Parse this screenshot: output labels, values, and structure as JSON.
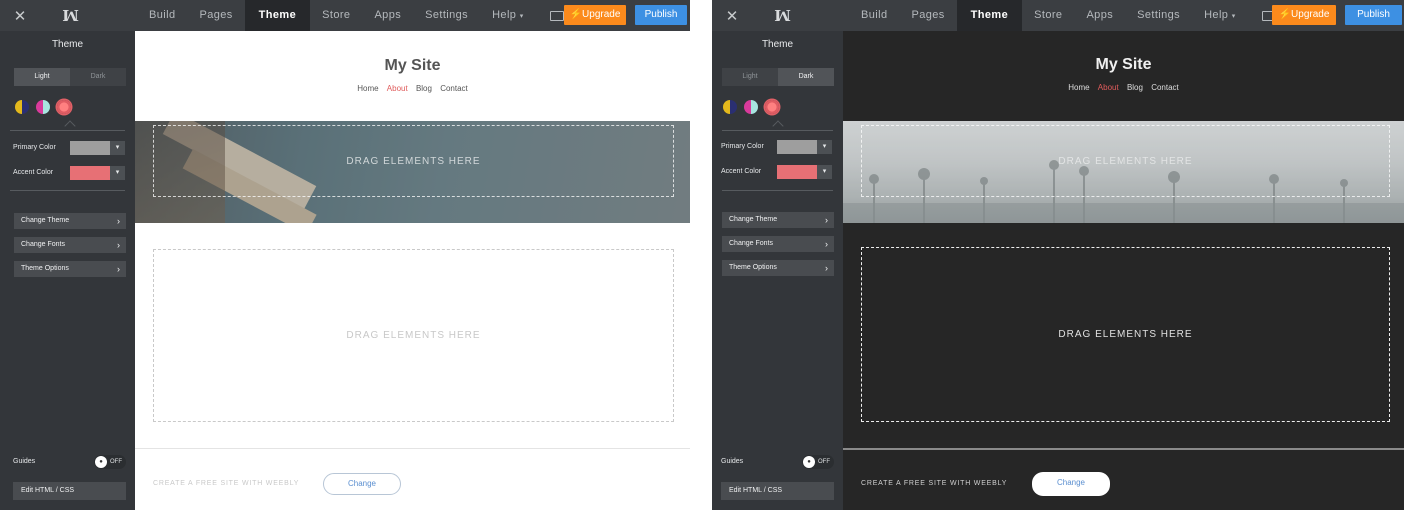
{
  "topbar": {
    "nav": [
      "Build",
      "Pages",
      "Theme",
      "Store",
      "Apps",
      "Settings",
      "Help"
    ],
    "help_caret": "▾",
    "upgrade_label": "Upgrade",
    "upgrade_icon": "⚡",
    "publish_label": "Publish",
    "accent_upgrade": "#fb8a1c",
    "accent_publish": "#3d90e3"
  },
  "sidebar": {
    "title": "Theme",
    "mode_light": "Light",
    "mode_dark": "Dark",
    "swatch_icons": [
      "yellow-navy-swatch-icon",
      "magenta-aqua-swatch-icon",
      "coral-swatch-icon"
    ],
    "primary_label": "Primary Color",
    "accent_label": "Accent Color",
    "primary_color": "#9e9e9e",
    "accent_color": "#e77075",
    "menu": [
      "Change Theme",
      "Change Fonts",
      "Theme Options"
    ],
    "guides_label": "Guides",
    "guides_state": "OFF",
    "edit_css": "Edit HTML / CSS"
  },
  "site": {
    "title": "My Site",
    "nav": [
      "Home",
      "About",
      "Blog",
      "Contact"
    ],
    "active_nav": "About",
    "drop_text": "DRAG ELEMENTS HERE",
    "footer_text": "CREATE A FREE SITE WITH WEEBLY",
    "change_label": "Change"
  },
  "panels": [
    {
      "mode": "Light",
      "canvas_bg": "#ffffff"
    },
    {
      "mode": "Dark",
      "canvas_bg": "#262626"
    }
  ]
}
